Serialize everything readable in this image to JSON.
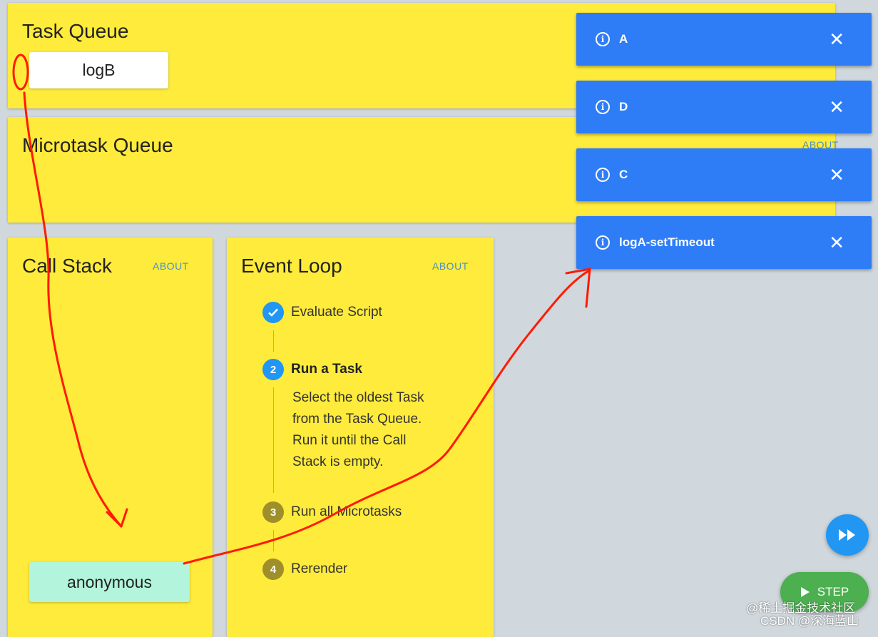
{
  "task_queue": {
    "title": "Task Queue",
    "items": [
      "logB"
    ]
  },
  "microtask_queue": {
    "title": "Microtask Queue",
    "about": "ABOUT"
  },
  "call_stack": {
    "title": "Call Stack",
    "about": "ABOUT",
    "items": [
      "anonymous"
    ]
  },
  "event_loop": {
    "title": "Event Loop",
    "about": "ABOUT",
    "steps": [
      {
        "num": "✓",
        "label": "Evaluate Script",
        "state": "done"
      },
      {
        "num": "2",
        "label": "Run a Task",
        "state": "active",
        "desc": [
          "Select the oldest Task",
          "from the Task Queue.",
          "Run it until the Call",
          "Stack is empty."
        ]
      },
      {
        "num": "3",
        "label": "Run all Microtasks",
        "state": "pending"
      },
      {
        "num": "4",
        "label": "Rerender",
        "state": "pending"
      }
    ]
  },
  "toasts": [
    {
      "message": "A"
    },
    {
      "message": "D"
    },
    {
      "message": "C"
    },
    {
      "message": "logA-setTimeout"
    }
  ],
  "controls": {
    "step_label": "STEP"
  },
  "watermark": {
    "line1": "@稀土掘金技术社区",
    "line2": "CSDN @深海蓝山"
  },
  "colors": {
    "card": "#ffeb3b",
    "toast": "#2e7df7",
    "accent": "#2196f3",
    "step_button": "#4caf50",
    "annotation": "#ff1a00"
  }
}
